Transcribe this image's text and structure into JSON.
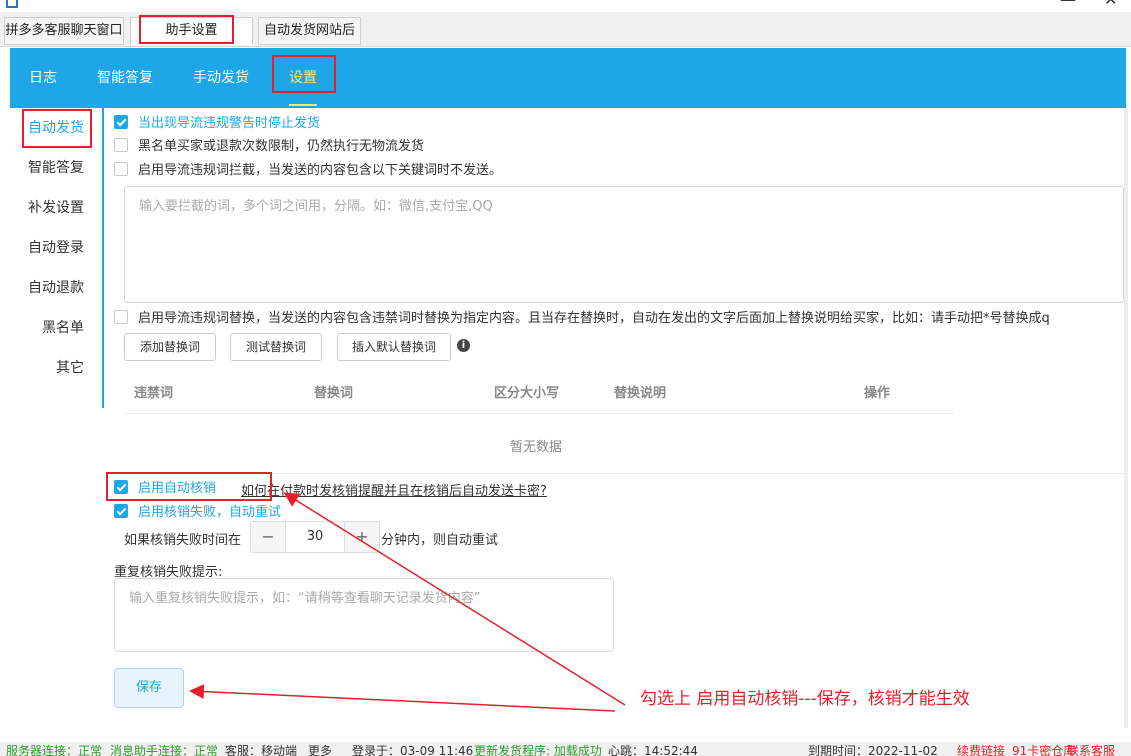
{
  "window": {
    "top_tabs": [
      "拼多多客服聊天窗口",
      "助手设置",
      "自动发货网站后台"
    ],
    "active_tab": 1
  },
  "nav": {
    "items": [
      "日志",
      "智能答复",
      "手动发货",
      "设置"
    ],
    "active": 3
  },
  "sidebar": {
    "items": [
      "自动发货",
      "智能答复",
      "补发设置",
      "自动登录",
      "自动退款",
      "黑名单",
      "其它"
    ],
    "active": 0
  },
  "options": {
    "stop_on_warning": {
      "label": "当出现导流违规警告时停止发货",
      "checked": true
    },
    "blacklist_limit": {
      "label": "黑名单买家或退款次数限制，仍然执行无物流发货",
      "checked": false
    },
    "block_keywords": {
      "label": "启用导流违规词拦截，当发送的内容包含以下关键词时不发送。",
      "checked": false
    },
    "block_keywords_placeholder": "输入要拦截的词，多个词之间用，分隔。如：微信,支付宝,QQ",
    "replace_words": {
      "label": "启用导流违规词替换，当发送的内容包含违禁词时替换为指定内容。且当存在替换时，自动在发出的文字后面加上替换说明给买家，比如：请手动把*号替换成q",
      "checked": false
    }
  },
  "replace_buttons": {
    "add": "添加替换词",
    "test": "测试替换词",
    "insert_default": "插入默认替换词"
  },
  "table": {
    "headers": [
      "违禁词",
      "替换词",
      "区分大小写",
      "替换说明",
      "操作"
    ],
    "empty_text": "暂无数据"
  },
  "verify": {
    "enable": {
      "label": "启用自动核销",
      "checked": true
    },
    "help_link": "如何在付款时发核销提醒并且在核销后自动发送卡密?",
    "retry": {
      "label": "启用核销失败，自动重试",
      "checked": true
    },
    "retry_prefix": "如果核销失败时间在",
    "retry_minutes": "30",
    "retry_suffix": "分钟内，则自动重试",
    "fail_tip_title": "重复核销失败提示:",
    "fail_tip_placeholder": "输入重复核销失败提示，如：“请稍等查看聊天记录发货内容”"
  },
  "save_label": "保存",
  "annotation": "勾选上 启用自动核销---保存，核销才能生效",
  "status": {
    "server": "服务器连接：正常",
    "assistant": "消息助手连接：正常",
    "service": "客服：移动端",
    "more": "更多",
    "login": "登录于：03-09 11:46",
    "updater": "更新发货程序: 加载成功",
    "heartbeat": "心跳：14:52:44",
    "expire": "到期时间：2022-11-02",
    "renew": "续费链接",
    "kami": "91卡密仓库",
    "contact": "联系客服"
  },
  "colors": {
    "accent": "#1ea6e6",
    "annotation": "#e6202a",
    "ok": "#2a9a2a"
  }
}
